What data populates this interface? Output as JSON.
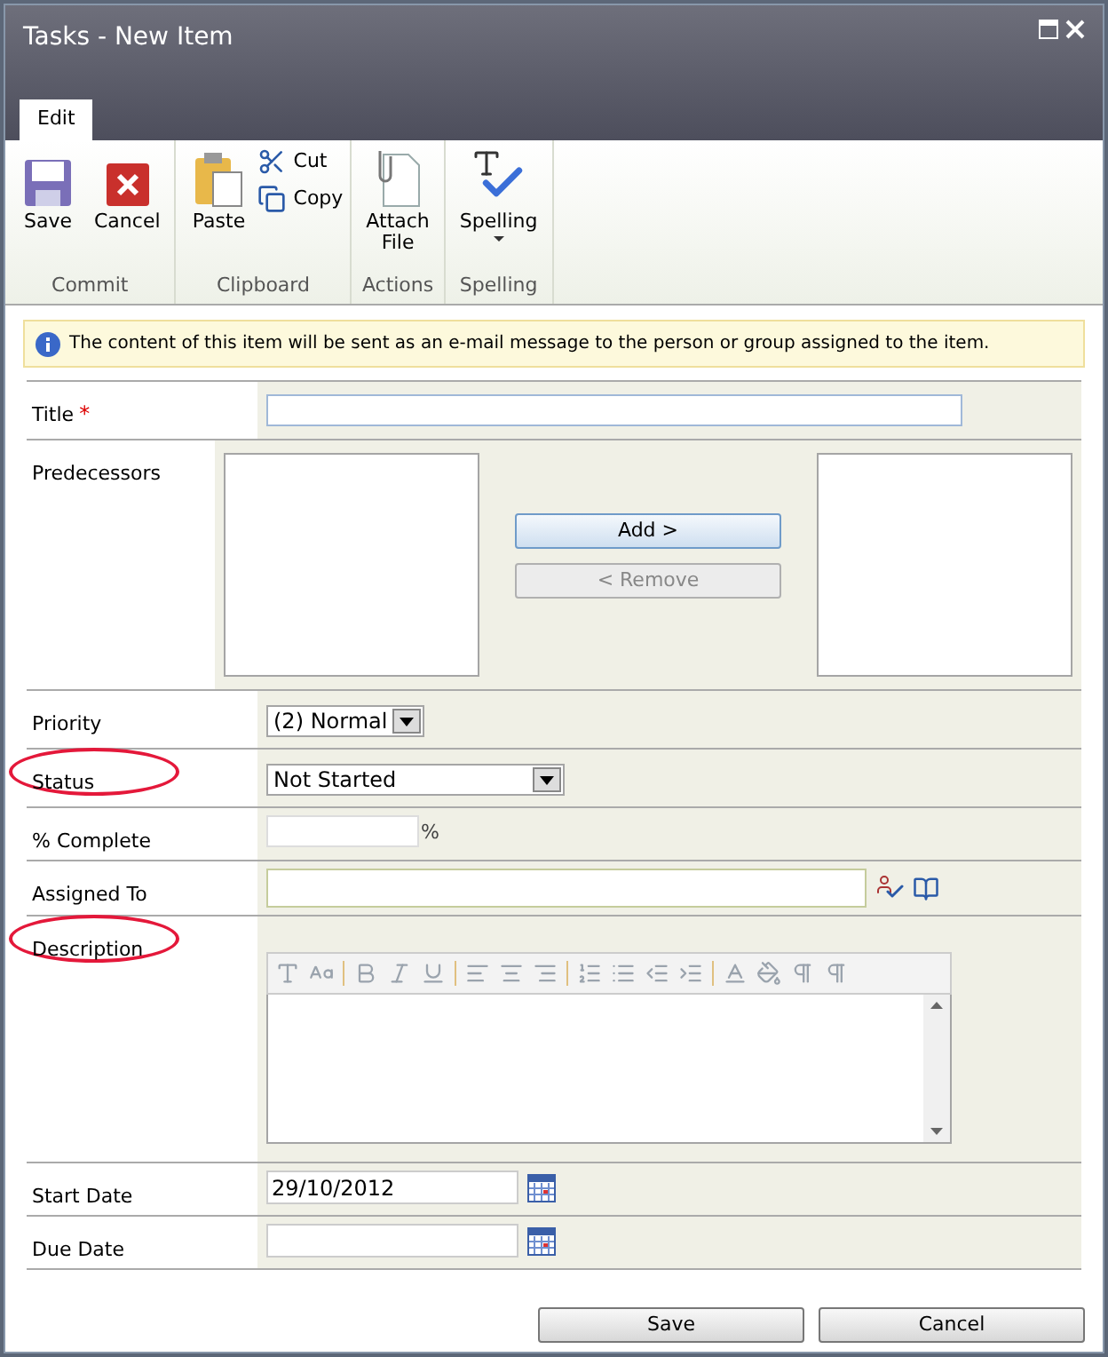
{
  "window": {
    "title": "Tasks - New Item"
  },
  "tabs": [
    {
      "label": "Edit",
      "selected": true
    }
  ],
  "ribbon": [
    {
      "group": "Commit",
      "items": [
        {
          "kind": "large",
          "label": "Save"
        },
        {
          "kind": "large",
          "label": "Cancel"
        }
      ]
    },
    {
      "group": "Clipboard",
      "items": [
        {
          "kind": "large",
          "label": "Paste"
        },
        {
          "kind": "small",
          "label": "Cut"
        },
        {
          "kind": "small",
          "label": "Copy"
        }
      ]
    },
    {
      "group": "Actions",
      "items": [
        {
          "kind": "large",
          "label": "Attach File"
        }
      ]
    },
    {
      "group": "Spelling",
      "items": [
        {
          "kind": "large",
          "label": "Spelling",
          "dropdown": true
        }
      ]
    }
  ],
  "info": "The content of this item will be sent as an e-mail message to the person or group assigned to the item.",
  "fields": [
    {
      "label": "Title",
      "required_mark": "*",
      "kind": "text",
      "circled": false
    },
    {
      "label": "Predecessors",
      "kind": "picker",
      "circled": false,
      "add": "Add >",
      "remove": "< Remove",
      "remove_disabled": true
    },
    {
      "label": "Priority",
      "kind": "select",
      "circled": false,
      "value": "(2) Normal"
    },
    {
      "label": "Status",
      "kind": "select_wide",
      "circled": true,
      "value": "Not Started"
    },
    {
      "label": "% Complete",
      "kind": "percent",
      "circled": false,
      "suffix": "%"
    },
    {
      "label": "Assigned To",
      "kind": "people",
      "circled": false
    },
    {
      "label": "Description",
      "kind": "richtext",
      "circled": true
    },
    {
      "label": "Start Date",
      "kind": "date",
      "circled": false,
      "value": "29/10/2012"
    },
    {
      "label": "Due Date",
      "kind": "date",
      "circled": false
    }
  ],
  "buttons": [
    "Save",
    "Cancel"
  ]
}
